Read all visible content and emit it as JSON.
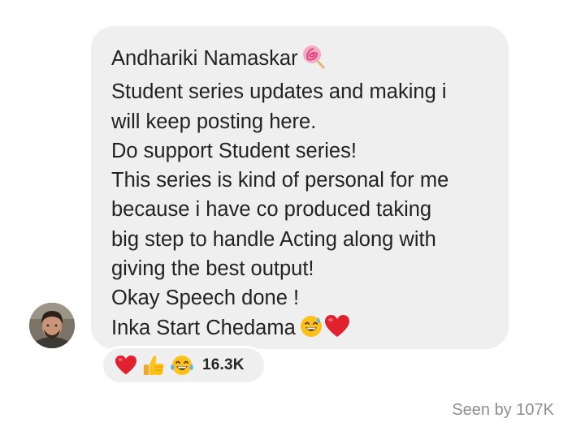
{
  "message": {
    "lines": [
      "Andhariki Namaskar",
      "Student series updates and making i",
      "will keep posting here.",
      "Do support Student series!",
      "This series is kind of personal for me",
      "because i have co produced taking",
      "big step to handle Acting along with",
      "giving the best output!",
      "Okay Speech done !",
      "Inka Start Chedama"
    ],
    "line1_emoji": "lollipop-icon",
    "last_line_emojis": [
      "sweat-smile-icon",
      "red-heart-icon"
    ]
  },
  "reactions": {
    "icons": [
      "red-heart-icon",
      "thumbs-up-icon",
      "tears-of-joy-icon"
    ],
    "count": "16.3K"
  },
  "seen": {
    "text": "Seen by 107K"
  },
  "colors": {
    "bubble_bg": "#efefef",
    "text": "#222222",
    "seen_text": "#8e8e8e",
    "heart": "#e0212e"
  }
}
